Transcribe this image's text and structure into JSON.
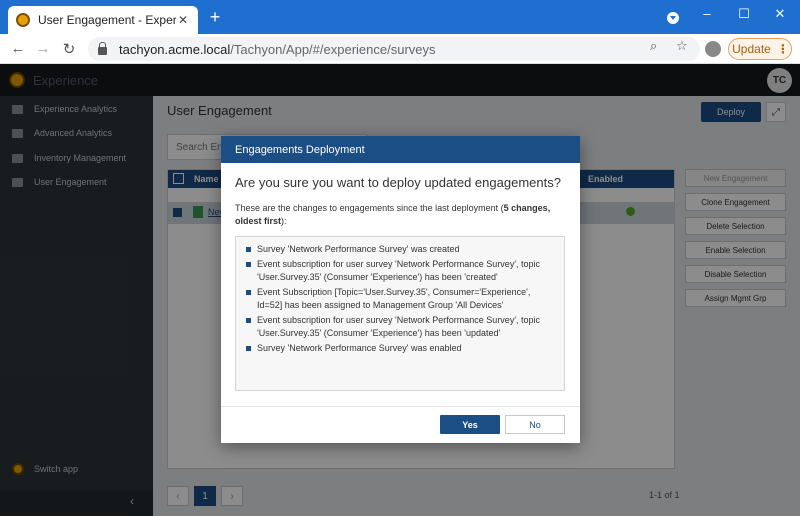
{
  "browser": {
    "tab_title": "User Engagement - Experience",
    "tab_close": "✕",
    "new_tab": "+",
    "url_host": "tachyon.acme.local",
    "url_path": "/Tachyon/App/#/experience/surveys",
    "update_label": "Update",
    "icons": [
      "back-icon",
      "forward-icon",
      "reload-icon",
      "lock-icon",
      "zoom-icon",
      "star-icon",
      "profile-icon",
      "menu-icon"
    ]
  },
  "app": {
    "name": "Experience",
    "user_initials": "TC"
  },
  "sidebar": {
    "items": [
      {
        "label": "Experience Analytics"
      },
      {
        "label": "Advanced Analytics"
      },
      {
        "label": "Inventory Management"
      },
      {
        "label": "User Engagement"
      }
    ],
    "switch_app": "Switch app",
    "collapse": "‹"
  },
  "main": {
    "title": "User Engagement",
    "deploy_label": "Deploy",
    "search_placeholder": "Search Engag",
    "grid": {
      "col_name": "Name",
      "col_enabled": "Enabled",
      "row_name": "New"
    },
    "actions": [
      {
        "label": "New Engagement",
        "disabled": true
      },
      {
        "label": "Clone Engagement",
        "disabled": false
      },
      {
        "label": "Delete Selection",
        "disabled": false
      },
      {
        "label": "Enable Selection",
        "disabled": false
      },
      {
        "label": "Disable Selection",
        "disabled": false
      },
      {
        "label": "Assign Mgmt Grp",
        "disabled": false
      }
    ],
    "pager": {
      "prev": "‹",
      "page": "1",
      "next": "›",
      "count": "1-1 of 1"
    }
  },
  "modal": {
    "title": "Engagements Deployment",
    "question": "Are you sure you want to deploy updated engagements?",
    "intro_text": "These are the changes to engagements since the last deployment (",
    "intro_bold": "5 changes, oldest first",
    "intro_end": "):",
    "changes": [
      "Survey 'Network Performance Survey' was created",
      "Event subscription for user survey 'Network Performance Survey', topic 'User.Survey.35' (Consumer 'Experience') has been 'created'",
      "Event Subscription [Topic='User.Survey.35', Consumer='Experience', Id=52] has been assigned to Management Group 'All Devices'",
      "Event subscription for user survey 'Network Performance Survey', topic 'User.Survey.35' (Consumer 'Experience') has been 'updated'",
      "Survey 'Network Performance Survey' was enabled"
    ],
    "yes_label": "Yes",
    "no_label": "No"
  }
}
